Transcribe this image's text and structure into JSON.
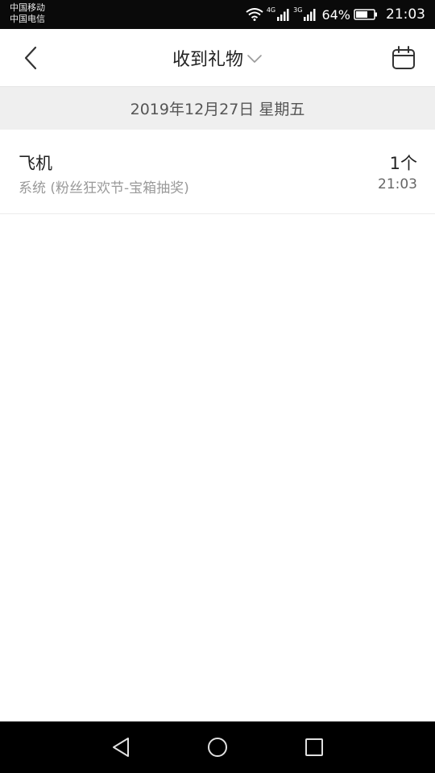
{
  "status_bar": {
    "carrier_1": "中国移动",
    "carrier_2": "中国电信",
    "net_1": "4G",
    "net_2": "3G",
    "battery": "64%",
    "time": "21:03",
    "icons": [
      "wifi-icon",
      "signal-icon",
      "signal-icon",
      "battery-icon"
    ]
  },
  "header": {
    "title": "收到礼物",
    "back_icon": "chevron-left-icon",
    "dropdown_icon": "chevron-down-icon",
    "calendar_icon": "calendar-icon"
  },
  "date_section": {
    "label": "2019年12月27日 星期五"
  },
  "gifts": [
    {
      "name": "飞机",
      "source": "系统 (粉丝狂欢节-宝箱抽奖)",
      "count": "1个",
      "time": "21:03"
    }
  ],
  "system_nav": {
    "icons": [
      "back-triangle-icon",
      "home-circle-icon",
      "recents-square-icon"
    ]
  },
  "colors": {
    "status_bar_bg": "#0a0a0a",
    "date_band_bg": "#efefef",
    "title_text": "#222222",
    "secondary_text": "#9a9a9a"
  }
}
